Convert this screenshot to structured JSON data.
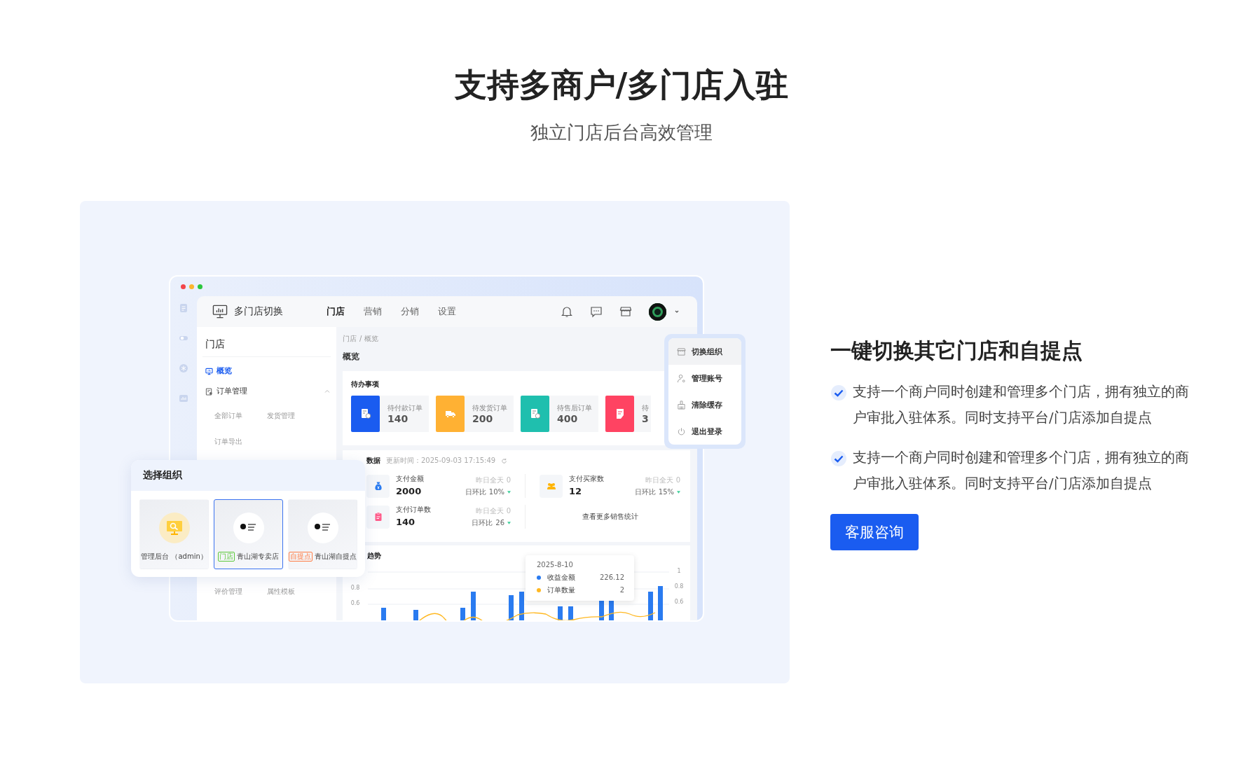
{
  "hero": {
    "title": "支持多商户/多门店入驻",
    "subtitle": "独立门店后台高效管理"
  },
  "mockup": {
    "app_name": "多门店切换",
    "nav_tabs": [
      {
        "label": "门店",
        "selected": true
      },
      {
        "label": "营销",
        "selected": false
      },
      {
        "label": "分销",
        "selected": false
      },
      {
        "label": "设置",
        "selected": false
      }
    ],
    "sidebar": {
      "title": "门店",
      "items": [
        {
          "label": "概览",
          "selected": true,
          "kind": "overview"
        },
        {
          "label": "订单管理",
          "selected": false,
          "kind": "orders",
          "expanded": true,
          "children": [
            {
              "label": "全部订单",
              "selected": false
            },
            {
              "label": "发货管理",
              "selected": false
            },
            {
              "label": "订单导出",
              "selected": false
            }
          ]
        }
      ],
      "more_items": [
        {
          "label": "评价管理",
          "selected": false
        },
        {
          "label": "属性模板",
          "selected": false
        }
      ]
    },
    "breadcrumb": {
      "items": [
        "门店",
        "概览"
      ],
      "separator": "/"
    },
    "page_title": "概览",
    "todo": {
      "title": "待办事项",
      "tiles": [
        {
          "label": "待付款订单",
          "value": "140",
          "color": "#1a5cf0",
          "kind": "receipt"
        },
        {
          "label": "待发货订单",
          "value": "200",
          "color": "#ffb133",
          "kind": "truck"
        },
        {
          "label": "待售后订单",
          "value": "400",
          "color": "#1fbfae",
          "kind": "refund"
        },
        {
          "label": "待",
          "value": "3",
          "color": "#ff4362",
          "kind": "note"
        }
      ]
    },
    "stats": {
      "title": "数据",
      "updated": "更新时间：2025-09-03 17:15:49",
      "items": [
        {
          "label": "支付金额",
          "value": "2000",
          "yesterday": "昨日全天 0",
          "change_label": "日环比",
          "change": "10%",
          "kind": "money"
        },
        {
          "label": "支付买家数",
          "value": "12",
          "yesterday": "昨日全天 0",
          "change_label": "日环比",
          "change": "15%",
          "kind": "buyers"
        },
        {
          "label": "支付订单数",
          "value": "140",
          "yesterday": "昨日全天 0",
          "change_label": "日环比",
          "change": "26",
          "kind": "orders"
        }
      ],
      "more_link": "查看更多销售统计"
    },
    "trend": {
      "title": "趋势",
      "left_axis": [
        "0.8",
        "0.6"
      ],
      "right_axis": [
        "1",
        "0.8",
        "0.6"
      ],
      "tooltip": {
        "date": "2025-8-10",
        "rows": [
          {
            "label": "收益金额",
            "value": "226.12",
            "color": "#2a7bf0"
          },
          {
            "label": "订单数量",
            "value": "2",
            "color": "#ffb822"
          }
        ]
      }
    },
    "account_menu": {
      "items": [
        {
          "label": "切换组织",
          "selected": true,
          "kind": "store"
        },
        {
          "label": "管理账号",
          "selected": false,
          "kind": "account"
        },
        {
          "label": "清除缓存",
          "selected": false,
          "kind": "broom"
        },
        {
          "label": "退出登录",
          "selected": false,
          "kind": "power"
        }
      ]
    },
    "org_picker": {
      "title": "选择组织",
      "options": [
        {
          "label": "管理后台 （admin）",
          "selected": false,
          "kind": "admin"
        },
        {
          "label": "青山湖专卖店",
          "tag": "门店",
          "color": "#5cc93b",
          "selected": true,
          "kind": "store"
        },
        {
          "label": "青山湖自提点",
          "tag": "自提点",
          "color": "#ff7d45",
          "selected": false,
          "kind": "store"
        }
      ]
    }
  },
  "feature": {
    "title": "一键切换其它门店和自提点",
    "points": [
      "支持一个商户同时创建和管理多个门店，拥有独立的商户审批入驻体系。同时支持平台/门店添加自提点",
      "支持一个商户同时创建和管理多个门店，拥有独立的商户审批入驻体系。同时支持平台/门店添加自提点"
    ],
    "button": "客服咨询"
  }
}
